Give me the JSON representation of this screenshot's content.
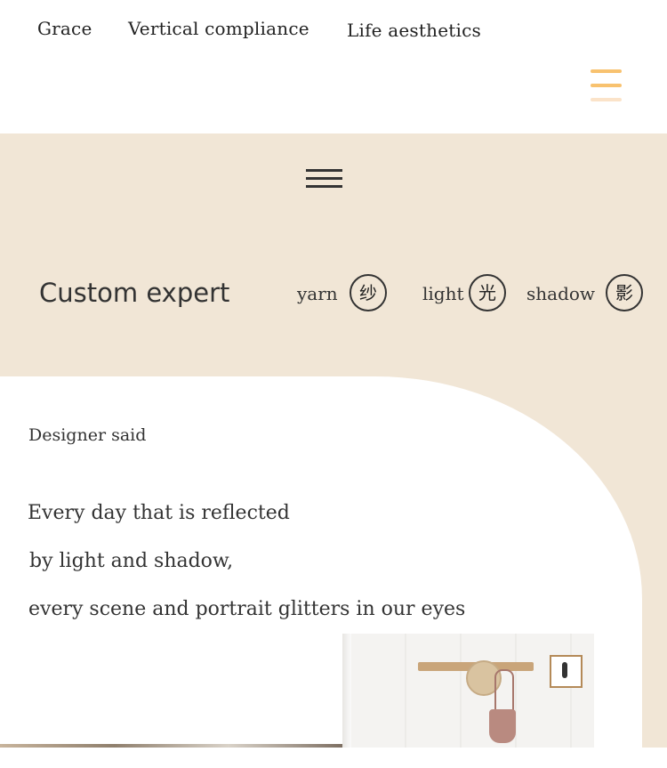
{
  "nav": {
    "links": [
      "Grace",
      "Vertical compliance",
      "Life aesthetics"
    ],
    "menu_icon": "hamburger-menu-icon",
    "accent_color": "#f8c26f"
  },
  "hero": {
    "background_color": "#f1e6d6",
    "center_menu_icon": "triple-bar-icon",
    "heading": "Custom expert",
    "features": [
      {
        "word": "yarn",
        "glyph": "纱"
      },
      {
        "word": "light",
        "glyph": "光"
      },
      {
        "word": "shadow",
        "glyph": "影"
      }
    ]
  },
  "designer": {
    "label": "Designer said",
    "quote_lines": [
      "Every day that is reflected",
      "by light and shadow,",
      "every scene and portrait glitters in our eyes"
    ]
  },
  "photo": {
    "subject": "interior-photo"
  }
}
